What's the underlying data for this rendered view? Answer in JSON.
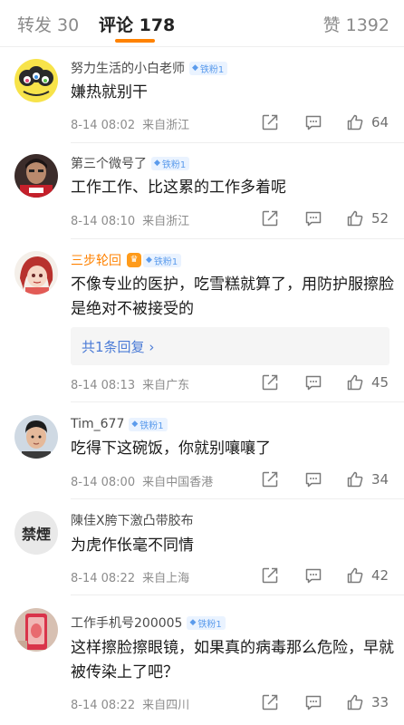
{
  "tabs": {
    "repost": "转发 30",
    "comments": "评论 178",
    "likes": "赞 1392"
  },
  "badge_label": "铁粉1",
  "reply_label": "共1条回复",
  "comments": [
    {
      "username": "努力生活的小白老师",
      "content": "嫌热就别干",
      "time": "8-14 08:02",
      "location": "来自浙江",
      "likes": "64"
    },
    {
      "username": "第三个微号了",
      "content": "工作工作、比这累的工作多着呢",
      "time": "8-14 08:10",
      "location": "来自浙江",
      "likes": "52"
    },
    {
      "username": "三步轮回",
      "content": "不像专业的医护，吃雪糕就算了，用防护服擦脸是绝对不被接受的",
      "time": "8-14 08:13",
      "location": "来自广东",
      "likes": "45"
    },
    {
      "username": "Tim_677",
      "content": "吃得下这碗饭，你就别嚷嚷了",
      "time": "8-14 08:00",
      "location": "来自中国香港",
      "likes": "34"
    },
    {
      "username": "陳佳X胯下激凸带胶布",
      "content": "为虎作伥毫不同情",
      "time": "8-14 08:22",
      "location": "来自上海",
      "likes": "42"
    },
    {
      "username": "工作手机号200005",
      "content": "这样擦脸擦眼镜，如果真的病毒那么危险，早就被传染上了吧？",
      "time": "8-14 08:22",
      "location": "来自四川",
      "likes": "33"
    }
  ],
  "avatar_text": {
    "c5": "禁煙"
  },
  "icons": [
    "share-icon",
    "comment-icon",
    "like-icon",
    "chevron-right-icon",
    "diamond-icon",
    "vip-icon"
  ],
  "colors": {
    "accent": "#ff8200",
    "badge_text": "#5b9bec",
    "badge_bg": "#eaf3ff",
    "link": "#4b7bd6"
  }
}
